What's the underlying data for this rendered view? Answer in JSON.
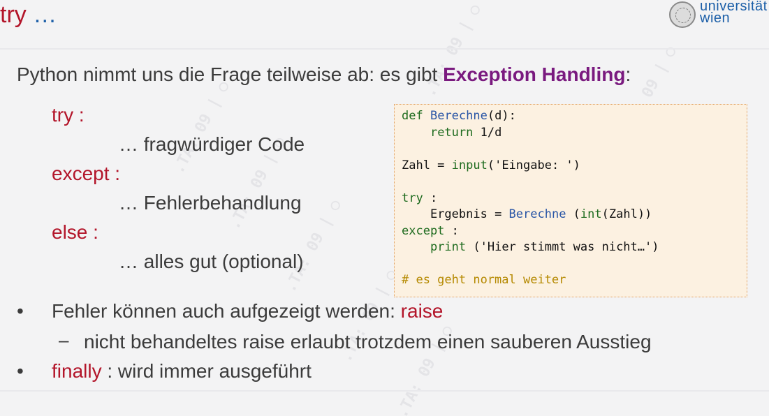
{
  "title": {
    "text": "try",
    "dots": "…"
  },
  "logo": {
    "line1": "universität",
    "line2": "wien"
  },
  "intro": {
    "before": "Python nimmt uns die Frage teilweise ab: es gibt ",
    "highlight": "Exception Handling",
    "after": ":"
  },
  "syntax": [
    {
      "text": "try :",
      "style": "keyword"
    },
    {
      "text": "… fragwürdiger Code",
      "style": "indented"
    },
    {
      "text": "except :",
      "style": "keyword"
    },
    {
      "text": "… Fehlerbehandlung",
      "style": "indented"
    },
    {
      "text": "else :",
      "style": "keyword"
    },
    {
      "text": "… alles gut (optional)",
      "style": "indented"
    }
  ],
  "code": {
    "def_kw": "def",
    "func_name": "Berechne",
    "def_args": "(d):",
    "return_kw": "return",
    "return_expr": " 1/d",
    "assign_lhs": "Zahl = ",
    "input_fn": "input",
    "input_args": "('Eingabe: ')",
    "try_kw": "try",
    "try_colon": " :",
    "result_lhs": "Ergebnis = ",
    "call_fn": "Berechne",
    "call_open": " (",
    "int_fn": "int",
    "call_args": "(Zahl))",
    "except_kw": "except",
    "except_colon": " :",
    "print_fn": "print",
    "print_args": " ('Hier stimmt was nicht…')",
    "comment": "# es geht normal weiter"
  },
  "bullets": {
    "b1_marker": "•",
    "b1_before": "Fehler können auch aufgezeigt werden: ",
    "b1_keyword": "raise",
    "b2_marker": "–",
    "b2_text": "nicht behandeltes raise erlaubt trotzdem einen sauberen Ausstieg",
    "b3_marker": "•",
    "b3_keyword": "finally",
    "b3_after": " : wird immer ausgeführt"
  },
  "colors": {
    "accent_red": "#b3152a",
    "accent_purple": "#7a1a7f",
    "brand_blue": "#1c5fa8",
    "code_bg": "#fcf1e1",
    "code_keyword": "#1e6b1e",
    "code_function": "#2a56a6",
    "code_comment": "#b58900"
  }
}
